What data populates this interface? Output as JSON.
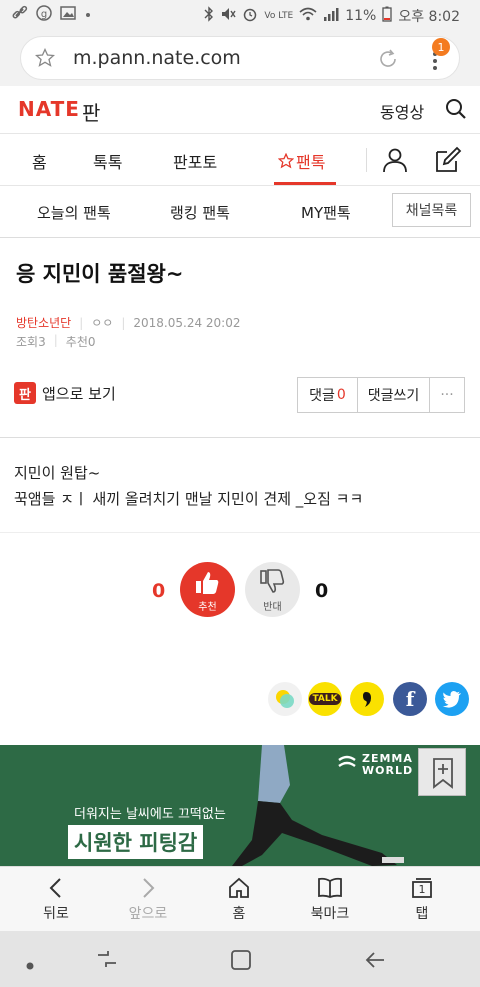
{
  "status_bar": {
    "battery": "11%",
    "time": "오후 8:02",
    "network": "Vo LTE"
  },
  "browser": {
    "url": "m.pann.nate.com",
    "tab_badge": "1"
  },
  "header": {
    "logo": "NATE",
    "logo_suffix": "판",
    "video_label": "동영상"
  },
  "nav": {
    "items": [
      "홈",
      "톡톡",
      "판포토",
      "팬톡"
    ],
    "active": "팬톡"
  },
  "subnav": {
    "items": [
      "오늘의 팬톡",
      "랭킹 팬톡",
      "MY팬톡"
    ],
    "channel_button": "채널목록"
  },
  "post": {
    "title": "응 지민이 품절왕~",
    "category": "방탄소년단",
    "author": "ㅇㅇ",
    "date": "2018.05.24 20:02",
    "views_label": "조회",
    "views": "3",
    "recommend_label": "추천",
    "recommend": "0",
    "app_view": "앱으로 보기",
    "comment_label": "댓글",
    "comment_count": "0",
    "write_comment": "댓글쓰기",
    "more": "···",
    "content_lines": [
      "지민이 원탑~",
      "꾹앰들 ㅈㅣ 새끼 올려치기 맨날 지민이 견제 _오짐 ㅋㅋ"
    ]
  },
  "vote": {
    "up_count": "0",
    "up_label": "추천",
    "down_count": "0",
    "down_label": "반대"
  },
  "share": {
    "kakaotalk": "TALK",
    "facebook": "f"
  },
  "banner": {
    "brand_line1": "ZEMMA",
    "brand_line2": "WORLD",
    "subtitle": "더워지는 날씨에도 끄떡없는",
    "headline": "시원한 피팅감"
  },
  "toolbar": {
    "back": "뒤로",
    "forward": "앞으로",
    "home": "홈",
    "bookmarks": "북마크",
    "tabs": "탭",
    "tab_count": "1"
  },
  "colors": {
    "accent": "#e5372a",
    "banner_green": "#2d6a45",
    "kakao_yellow": "#fae100",
    "facebook": "#3b5998",
    "twitter": "#1da1f2"
  }
}
